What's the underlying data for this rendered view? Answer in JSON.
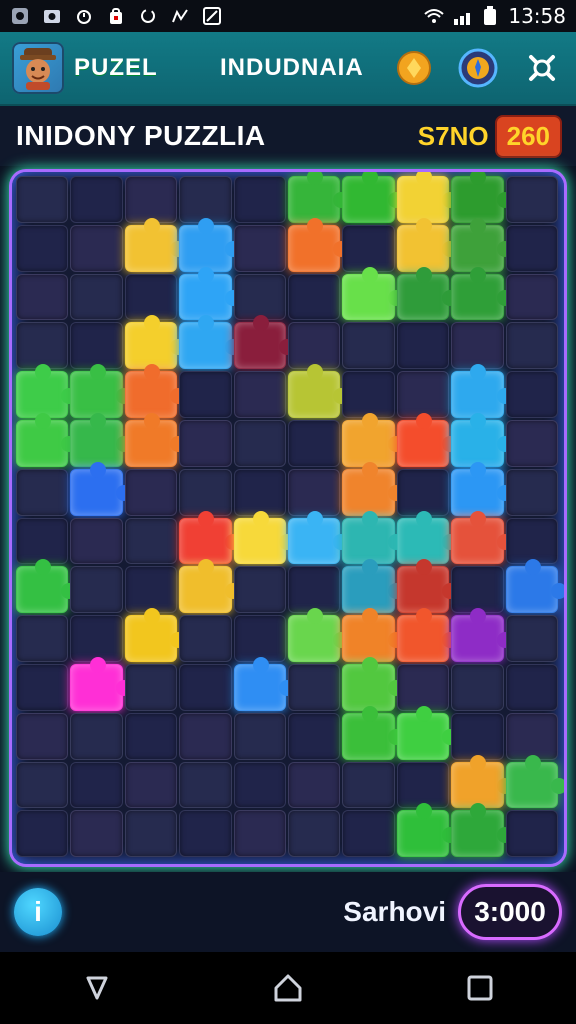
{
  "status_bar": {
    "time": "13:58"
  },
  "app_bar": {
    "brand": "PUZEL",
    "title": "INDUDNAIA",
    "icons": [
      "coin-icon",
      "badge-icon",
      "settings-icon"
    ]
  },
  "game_header": {
    "title": "INIDONY PUZZLIA",
    "score_label": "S7NO",
    "score_value": "260"
  },
  "board": {
    "pieces": [
      {
        "row": 0,
        "col": 5,
        "color": "#36b53a"
      },
      {
        "row": 0,
        "col": 6,
        "color": "#31b832"
      },
      {
        "row": 0,
        "col": 7,
        "color": "#f2d234"
      },
      {
        "row": 0,
        "col": 8,
        "color": "#2d9c2e"
      },
      {
        "row": 1,
        "col": 2,
        "color": "#f2c232"
      },
      {
        "row": 1,
        "col": 3,
        "color": "#2f9ef2"
      },
      {
        "row": 1,
        "col": 5,
        "color": "#f1712a"
      },
      {
        "row": 1,
        "col": 7,
        "color": "#f2c232"
      },
      {
        "row": 1,
        "col": 8,
        "color": "#3ea13a"
      },
      {
        "row": 2,
        "col": 3,
        "color": "#2ea4f6"
      },
      {
        "row": 2,
        "col": 6,
        "color": "#68e04a"
      },
      {
        "row": 2,
        "col": 7,
        "color": "#2f9c3a"
      },
      {
        "row": 2,
        "col": 8,
        "color": "#2f9f38"
      },
      {
        "row": 3,
        "col": 2,
        "color": "#f4cf2c"
      },
      {
        "row": 3,
        "col": 3,
        "color": "#2fa7f2"
      },
      {
        "row": 3,
        "col": 4,
        "color": "#8a1e3c"
      },
      {
        "row": 4,
        "col": 0,
        "color": "#3ecc49"
      },
      {
        "row": 4,
        "col": 1,
        "color": "#39bf45"
      },
      {
        "row": 4,
        "col": 2,
        "color": "#f06c2c"
      },
      {
        "row": 4,
        "col": 5,
        "color": "#b7c534"
      },
      {
        "row": 4,
        "col": 8,
        "color": "#2ea9ee"
      },
      {
        "row": 5,
        "col": 0,
        "color": "#3fca45"
      },
      {
        "row": 5,
        "col": 1,
        "color": "#36b84b"
      },
      {
        "row": 5,
        "col": 2,
        "color": "#f07a28"
      },
      {
        "row": 5,
        "col": 6,
        "color": "#f1a42e"
      },
      {
        "row": 5,
        "col": 7,
        "color": "#f44d2c"
      },
      {
        "row": 5,
        "col": 8,
        "color": "#29b1e8"
      },
      {
        "row": 6,
        "col": 1,
        "color": "#2c6ff0"
      },
      {
        "row": 6,
        "col": 6,
        "color": "#f0842c"
      },
      {
        "row": 6,
        "col": 8,
        "color": "#2c97f4"
      },
      {
        "row": 7,
        "col": 3,
        "color": "#f04034"
      },
      {
        "row": 7,
        "col": 4,
        "color": "#f7d93a"
      },
      {
        "row": 7,
        "col": 5,
        "color": "#3ab4f4"
      },
      {
        "row": 7,
        "col": 6,
        "color": "#2db6b1"
      },
      {
        "row": 7,
        "col": 7,
        "color": "#2cbab6"
      },
      {
        "row": 7,
        "col": 8,
        "color": "#e5523b"
      },
      {
        "row": 8,
        "col": 0,
        "color": "#34c043"
      },
      {
        "row": 8,
        "col": 3,
        "color": "#f0be2c"
      },
      {
        "row": 8,
        "col": 6,
        "color": "#2a9dbd"
      },
      {
        "row": 8,
        "col": 7,
        "color": "#c5372d"
      },
      {
        "row": 8,
        "col": 9,
        "color": "#2c79e8"
      },
      {
        "row": 9,
        "col": 2,
        "color": "#f2c61e"
      },
      {
        "row": 9,
        "col": 5,
        "color": "#69d64d"
      },
      {
        "row": 9,
        "col": 6,
        "color": "#f08328"
      },
      {
        "row": 9,
        "col": 7,
        "color": "#f1562c"
      },
      {
        "row": 9,
        "col": 8,
        "color": "#8e2cc6"
      },
      {
        "row": 10,
        "col": 1,
        "color": "#ff2fd6"
      },
      {
        "row": 10,
        "col": 4,
        "color": "#2f8ef3"
      },
      {
        "row": 10,
        "col": 6,
        "color": "#52c83f"
      },
      {
        "row": 11,
        "col": 6,
        "color": "#3bbf3a"
      },
      {
        "row": 11,
        "col": 7,
        "color": "#3fcf41"
      },
      {
        "row": 12,
        "col": 8,
        "color": "#f0a22a"
      },
      {
        "row": 12,
        "col": 9,
        "color": "#39b84c"
      },
      {
        "row": 13,
        "col": 7,
        "color": "#2fbf3a"
      },
      {
        "row": 13,
        "col": 8,
        "color": "#2ea83a"
      }
    ],
    "dim_color": "#23284a"
  },
  "bottom_bar": {
    "hint_label": "i",
    "label": "Sarhovi",
    "timer": "3:000"
  },
  "nav": {
    "buttons": [
      "back-icon",
      "home-icon",
      "recents-icon"
    ]
  }
}
